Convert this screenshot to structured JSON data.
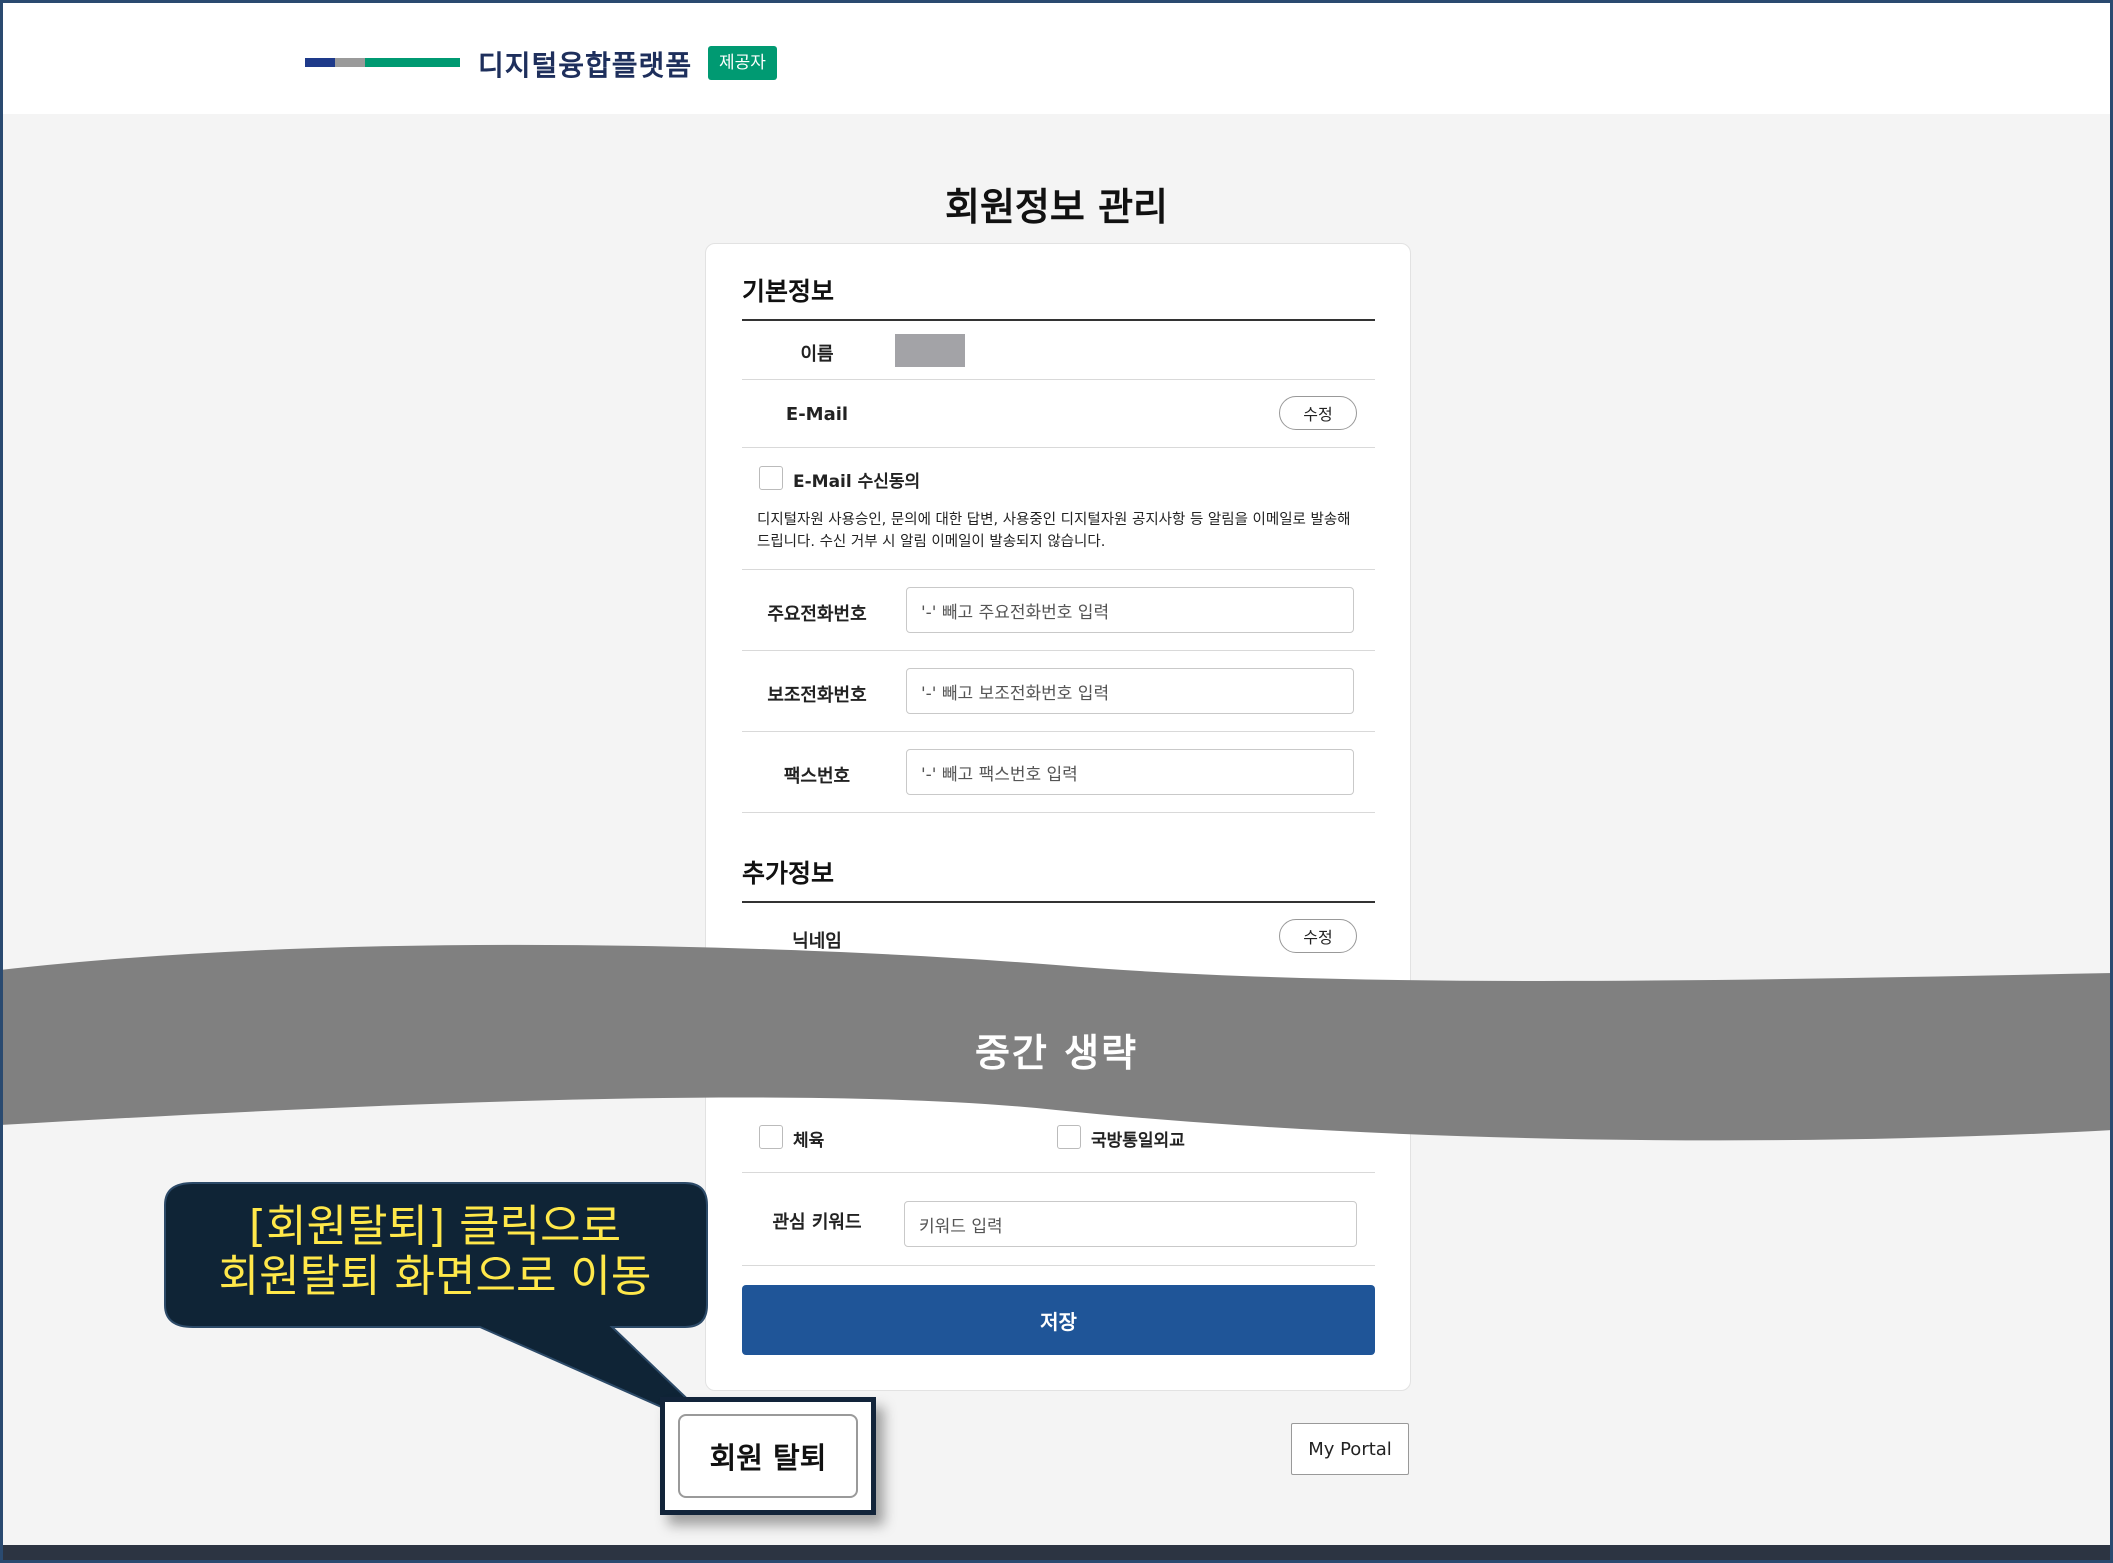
{
  "header": {
    "logo_text": "디지털융합플랫폼",
    "provider_badge": "제공자",
    "logo_colors": [
      "#1e3a8a",
      "#9a9a9a",
      "#009a72"
    ]
  },
  "page_title": "회원정보 관리",
  "basic_info": {
    "section_title": "기본정보",
    "name_label": "이름",
    "email_label": "E-Mail",
    "edit_label": "수정",
    "email_consent_label": "E-Mail 수신동의",
    "consent_text": "디지털자원 사용승인, 문의에 대한 답변, 사용중인 디지털자원 공지사항 등 알림을 이메일로 발송해 드립니다. 수신 거부 시 알림 이메일이 발송되지 않습니다.",
    "main_phone_label": "주요전화번호",
    "main_phone_placeholder": "'-' 빼고 주요전화번호 입력",
    "sub_phone_label": "보조전화번호",
    "sub_phone_placeholder": "'-' 빼고 보조전화번호 입력",
    "fax_label": "팩스번호",
    "fax_placeholder": "'-' 빼고 팩스번호 입력"
  },
  "extra_info": {
    "section_title": "추가정보",
    "nickname_label": "닉네임",
    "edit_label": "수정",
    "interest_options": [
      "체육",
      "국방통일외교"
    ],
    "keyword_label": "관심 키워드",
    "keyword_placeholder": "키워드 입력"
  },
  "omitted_text": "중간 생략",
  "save_label": "저장",
  "withdraw_label": "회원 탈퇴",
  "portal_label": "My Portal",
  "callout": {
    "line1": "[회원탈퇴] 클릭으로",
    "line2": "회원탈퇴 화면으로 이동"
  },
  "colors": {
    "save_button": "#1f5598",
    "badge": "#009a72",
    "callout_bg": "#0f2436",
    "callout_text": "#ffe84a",
    "omit_band": "#808080"
  }
}
